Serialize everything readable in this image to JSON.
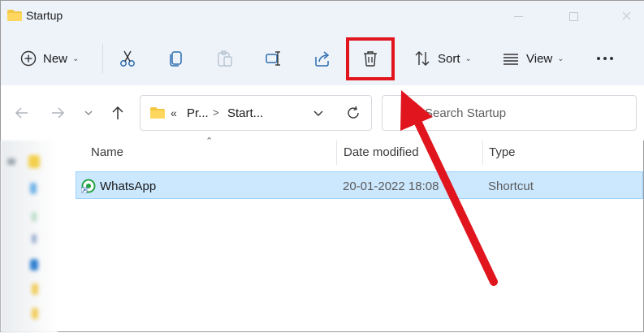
{
  "window": {
    "title": "Startup"
  },
  "toolbar": {
    "new_label": "New",
    "sort_label": "Sort",
    "view_label": "View",
    "icons": [
      "plus-circle-icon",
      "scissors-icon",
      "copy-icon",
      "paste-icon",
      "rename-icon",
      "share-icon",
      "trash-icon",
      "sort-icon",
      "view-icon",
      "more-icon"
    ]
  },
  "address": {
    "overflow": "«",
    "crumb1": "Pr...",
    "sep": ">",
    "crumb2": "Start..."
  },
  "search": {
    "placeholder": "Search Startup"
  },
  "columns": {
    "name": "Name",
    "date": "Date modified",
    "type": "Type"
  },
  "files": [
    {
      "name": "WhatsApp",
      "date": "20-01-2022 18:08",
      "type": "Shortcut"
    }
  ],
  "colors": {
    "accent_highlight": "#e0151e",
    "selection": "#cce8ff",
    "chrome": "#eef3fa"
  }
}
